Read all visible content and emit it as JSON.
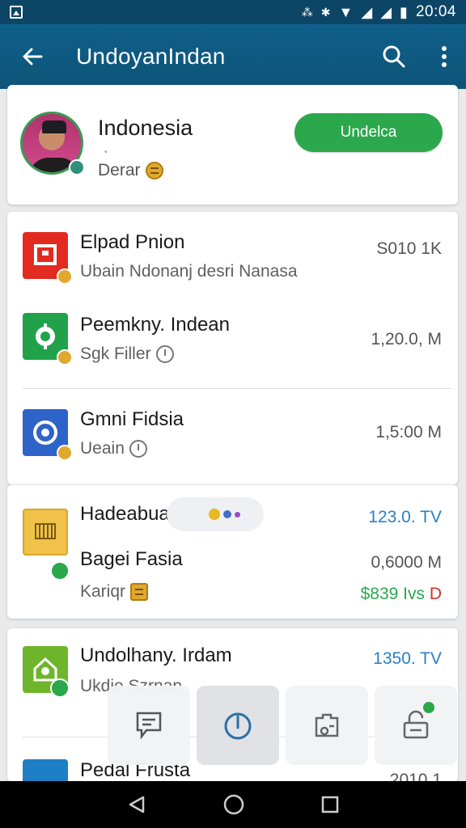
{
  "status_bar": {
    "time": "20:04"
  },
  "app_bar": {
    "title": "UndoyanIndan"
  },
  "profile": {
    "name": "Indonesia",
    "dot": "•",
    "subtitle": "Derar",
    "button_label": "Undelca"
  },
  "list": {
    "items": [
      {
        "title": "Elpad Pnion",
        "subtitle": "Ubain Ndonanj desri Nanasa",
        "value": "S010 1K",
        "icon": "square-app-icon",
        "icon_color": "#e32a20",
        "badge_color": "#e0a82e"
      },
      {
        "title": "Peemkny. Indean",
        "subtitle": "Sgk Filler",
        "value": "1,20.0, M",
        "icon": "gear-app-icon",
        "icon_color": "#21a24a",
        "badge_color": "#e0a82e"
      },
      {
        "title": "Gmni Fidsia",
        "subtitle": "Ueain",
        "value": "1,5:00 M",
        "icon": "swirl-app-icon",
        "icon_color": "#2e63c9",
        "badge_color": "#e0a82e"
      }
    ],
    "group": {
      "title": "Hadeabuain",
      "row2_title": "Bagei Fasia",
      "row3_title": "Kariqr",
      "value1": "123.0. TV",
      "value2": "0,6000 M",
      "value3a": "$839 Ivs",
      "value3b": "D",
      "colors": {
        "value1": "#2b7fc4",
        "value2_tail": "#d32f2f",
        "value3": "#2ba84c",
        "value3b": "#d32f2f"
      }
    },
    "items2": [
      {
        "title": "Undolhany. Irdam",
        "subtitle": "Ukdie Szrnan",
        "value": "1350. TV"
      },
      {
        "title": "Pedal Frusta",
        "value": "2010 1"
      }
    ]
  },
  "accent_colors": {
    "app_bar": "#0f5f8a",
    "green": "#2ba84c"
  }
}
